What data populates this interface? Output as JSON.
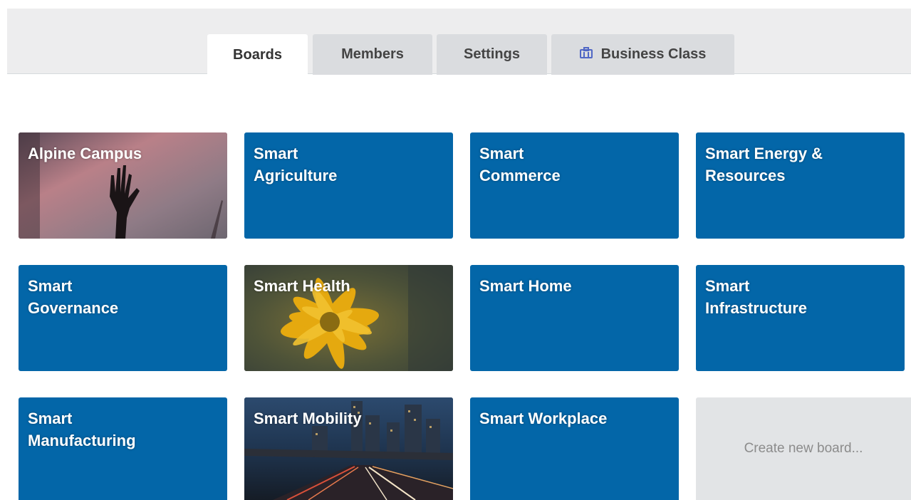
{
  "tabs": [
    {
      "label": "Boards",
      "active": true
    },
    {
      "label": "Members",
      "active": false
    },
    {
      "label": "Settings",
      "active": false
    },
    {
      "label": "Business Class",
      "active": false,
      "icon": "briefcase-icon"
    }
  ],
  "boards": [
    {
      "title": "Alpine Campus",
      "background": "photo-hand-sunset"
    },
    {
      "title": "Smart\nAgriculture",
      "background": "#0366a8"
    },
    {
      "title": "Smart\nCommerce",
      "background": "#0366a8"
    },
    {
      "title": "Smart Energy &\nResources",
      "background": "#0366a8"
    },
    {
      "title": "Smart\nGovernance",
      "background": "#0366a8"
    },
    {
      "title": "Smart Health",
      "background": "photo-yellow-flower"
    },
    {
      "title": "Smart Home",
      "background": "#0366a8"
    },
    {
      "title": "Smart\nInfrastructure",
      "background": "#0366a8"
    },
    {
      "title": "Smart\nManufacturing",
      "background": "#0366a8"
    },
    {
      "title": "Smart Mobility",
      "background": "photo-city-highway-night"
    },
    {
      "title": "Smart Workplace",
      "background": "#0366a8"
    }
  ],
  "create_board": {
    "label": "Create new board..."
  },
  "colors": {
    "board_blue": "#0366a8",
    "tab_bar": "#ededee",
    "tab_inactive": "#dadcdf",
    "icon_accent": "#5067c5"
  }
}
